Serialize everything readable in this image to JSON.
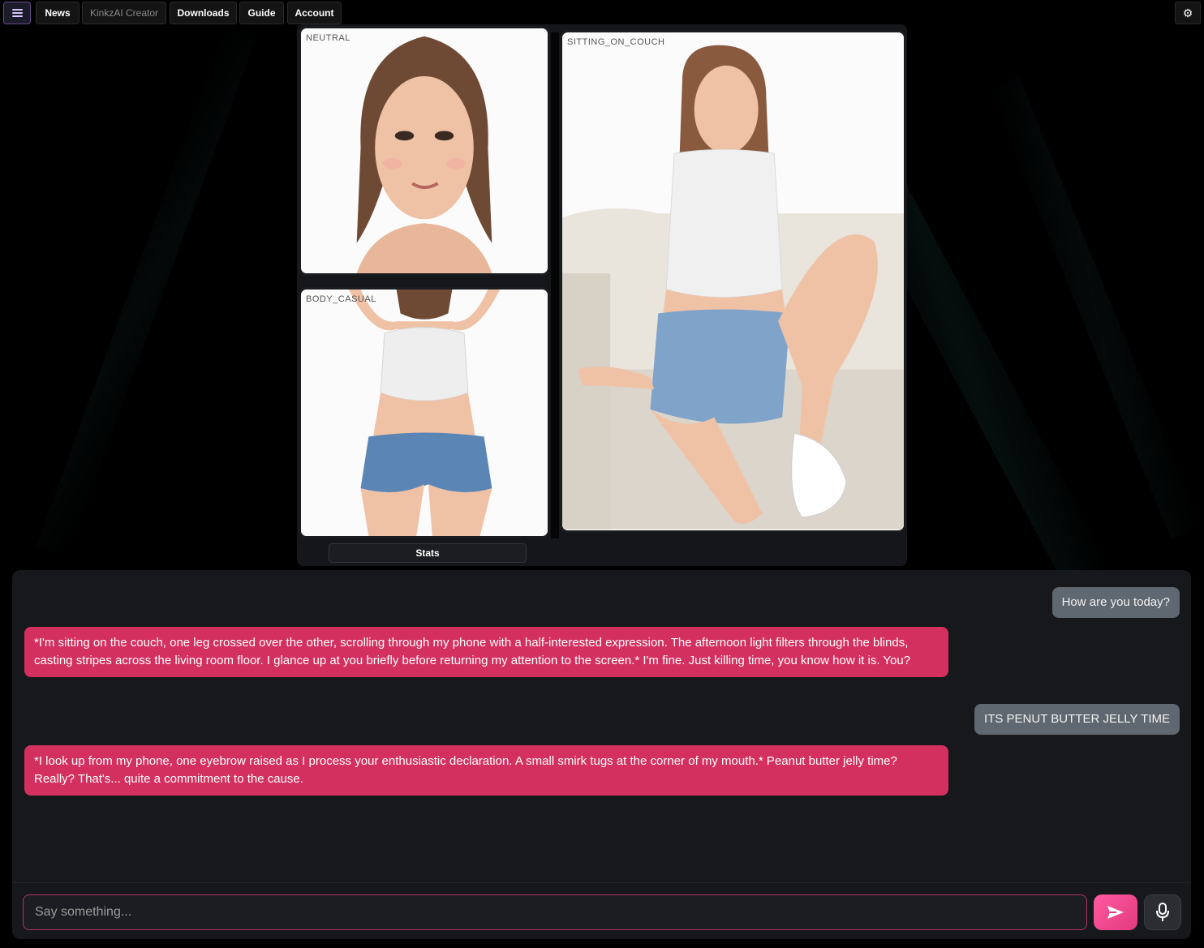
{
  "nav": {
    "tabs": [
      {
        "label": "News"
      },
      {
        "label": "KinkzAI Creator"
      },
      {
        "label": "Downloads"
      },
      {
        "label": "Guide"
      },
      {
        "label": "Account"
      }
    ],
    "menu_icon": "hamburger-icon",
    "settings_icon": "gear-icon"
  },
  "portraits": {
    "cards": [
      {
        "label": "NEUTRAL"
      },
      {
        "label": "BODY_CASUAL"
      },
      {
        "label": "SITTING_ON_COUCH"
      }
    ],
    "stats_label": "Stats"
  },
  "chat": {
    "messages": [
      {
        "role": "user",
        "text": "How are you today?"
      },
      {
        "role": "ai",
        "text": "*I'm sitting on the couch, one leg crossed over the other, scrolling through my phone with a half-interested expression. The afternoon light filters through the blinds, casting stripes across the living room floor. I glance up at you briefly before returning my attention to the screen.* I'm fine. Just killing time, you know how it is. You?"
      },
      {
        "role": "user",
        "text": "ITS PENUT BUTTER JELLY TIME"
      },
      {
        "role": "ai",
        "text": "*I look up from my phone, one eyebrow raised as I process your enthusiastic declaration. A small smirk tugs at the corner of my mouth.* Peanut butter jelly time? Really? That's... quite a commitment to the cause."
      }
    ],
    "input_placeholder": "Say something...",
    "send_icon": "send-icon",
    "mic_icon": "microphone-icon"
  },
  "colors": {
    "ai_bubble": "#d3305f",
    "user_bubble": "#5f6770",
    "accent": "#ff5aa0"
  }
}
